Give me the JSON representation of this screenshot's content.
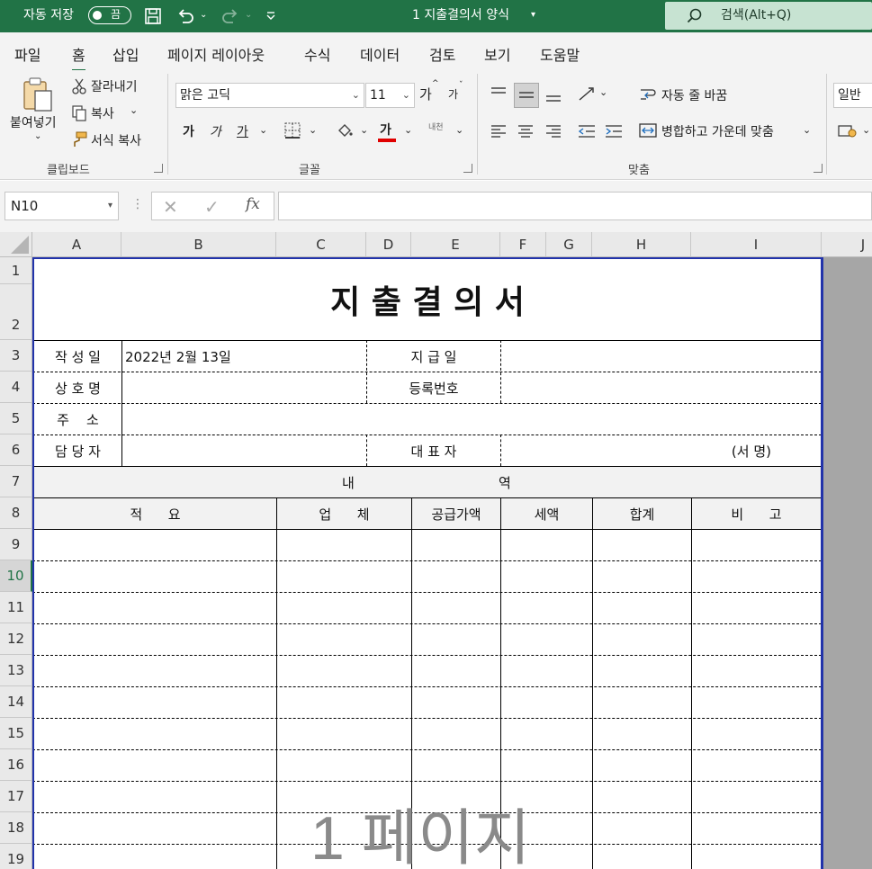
{
  "titlebar": {
    "autosave_label": "자동 저장",
    "autosave_state": "끔",
    "document_title": "1 지출결의서 양식",
    "search_placeholder": "검색(Alt+Q)"
  },
  "menu": {
    "tabs": [
      "파일",
      "홈",
      "삽입",
      "페이지 레이아웃",
      "수식",
      "데이터",
      "검토",
      "보기",
      "도움말"
    ],
    "active": "홈"
  },
  "ribbon": {
    "clipboard": {
      "paste": "붙여넣기",
      "cut": "잘라내기",
      "copy": "복사",
      "format_painter": "서식 복사",
      "group_label": "클립보드"
    },
    "font": {
      "font_name": "맑은 고딕",
      "font_size": "11",
      "grow": "가",
      "shrink": "가",
      "bold": "가",
      "italic": "가",
      "underline": "가",
      "font_color": "가",
      "phonetic": "내천",
      "group_label": "글꼴"
    },
    "alignment": {
      "wrap_text": "자동 줄 바꿈",
      "merge_center": "병합하고 가운데 맞춤",
      "group_label": "맞춤"
    },
    "number": {
      "format": "일반"
    }
  },
  "formula_bar": {
    "name_box": "N10",
    "fx": "fx",
    "formula": ""
  },
  "columns": [
    "A",
    "B",
    "C",
    "D",
    "E",
    "F",
    "G",
    "H",
    "I",
    "J"
  ],
  "rows": [
    "1",
    "2",
    "3",
    "4",
    "5",
    "6",
    "7",
    "8",
    "9",
    "10",
    "11",
    "12",
    "13",
    "14",
    "15",
    "16",
    "17",
    "18",
    "19"
  ],
  "selected_row": "10",
  "sheet": {
    "title": "지 출 결 의 서",
    "created_label": "작 성 일",
    "created_value": "2022년 2월 13일",
    "payment_label": "지 급 일",
    "company_label": "상 호 명",
    "regno_label": "등록번호",
    "address_label": "주    소",
    "manager_label": "담 당 자",
    "ceo_label": "대 표 자",
    "sign_label": "(서 명)",
    "details_left": "내",
    "details_right": "역",
    "head_summary": "적      요",
    "head_vendor": "업      체",
    "head_supply": "공급가액",
    "head_tax": "세액",
    "head_total": "합계",
    "head_remark": "비      고",
    "watermark": "1 페이지"
  }
}
